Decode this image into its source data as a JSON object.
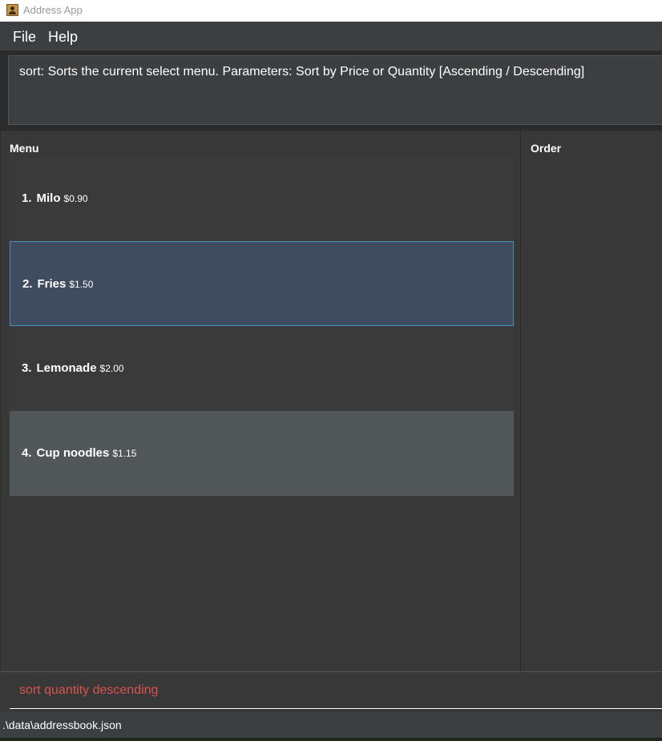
{
  "window": {
    "title": "Address App"
  },
  "menubar": {
    "file_label": "File",
    "help_label": "Help"
  },
  "result_display": {
    "text": "sort: Sorts the current select menu. Parameters:  Sort by Price or Quantity  [Ascending / Descending]"
  },
  "menu_panel": {
    "title": "Menu",
    "items": [
      {
        "index": "1.",
        "name": "Milo",
        "price": "$0.90",
        "state": "normal"
      },
      {
        "index": "2.",
        "name": "Fries",
        "price": "$1.50",
        "state": "selected"
      },
      {
        "index": "3.",
        "name": "Lemonade",
        "price": "$2.00",
        "state": "normal"
      },
      {
        "index": "4.",
        "name": "Cup noodles",
        "price": "$1.15",
        "state": "hovered"
      }
    ]
  },
  "order_panel": {
    "title": "Order"
  },
  "command_box": {
    "value": "sort quantity descending"
  },
  "status_bar": {
    "path": ".\\data\\addressbook.json"
  },
  "colors": {
    "background": "#383838",
    "selected_row": "#3f4b5e",
    "selected_border": "#4a8fb8",
    "hovered_row": "#515658",
    "command_text": "#d9534f"
  }
}
